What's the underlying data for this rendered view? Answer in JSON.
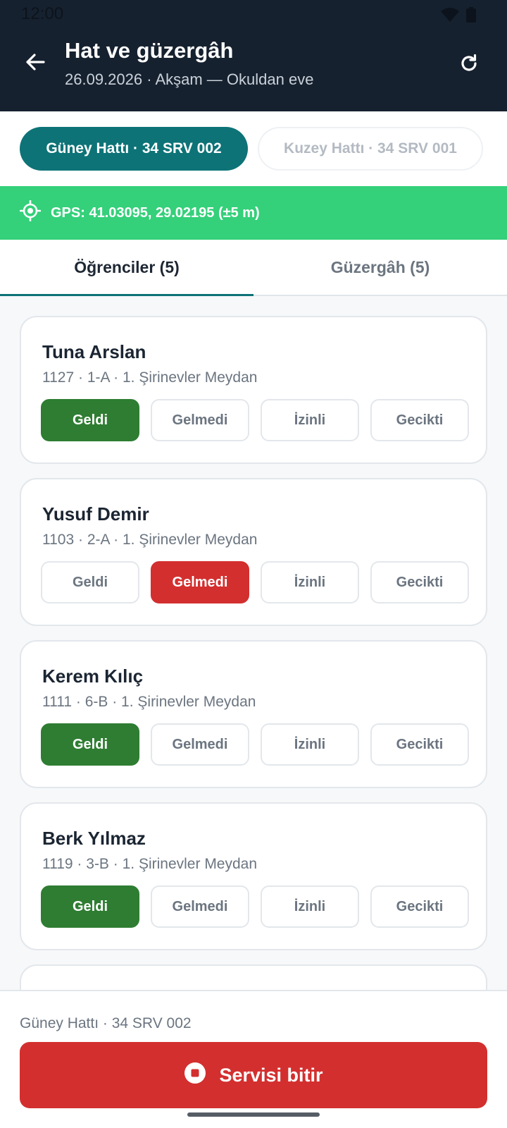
{
  "status_bar": {
    "time": "12:00"
  },
  "header": {
    "title": "Hat ve güzergâh",
    "subtitle": "26.09.2026 · Akşam — Okuldan eve"
  },
  "routes": [
    {
      "label": "Güney Hattı · 34 SRV 002",
      "selected": true
    },
    {
      "label": "Kuzey Hattı · 34 SRV 001",
      "selected": false
    }
  ],
  "gps": {
    "text": "GPS: 41.03095, 29.02195 (±5 m)"
  },
  "tabs": [
    {
      "label": "Öğrenciler (5)",
      "active": true
    },
    {
      "label": "Güzergâh (5)",
      "active": false
    }
  ],
  "attendance_options": [
    "Geldi",
    "Gelmedi",
    "İzinli",
    "Gecikti"
  ],
  "students": [
    {
      "name": "Tuna Arslan",
      "meta": "1127 · 1-A · 1. Şirinevler Meydan",
      "status": "Geldi"
    },
    {
      "name": "Yusuf Demir",
      "meta": "1103 · 2-A · 1. Şirinevler Meydan",
      "status": "Gelmedi"
    },
    {
      "name": "Kerem Kılıç",
      "meta": "1111 · 6-B · 1. Şirinevler Meydan",
      "status": "Geldi"
    },
    {
      "name": "Berk Yılmaz",
      "meta": "1119 · 3-B · 1. Şirinevler Meydan",
      "status": "Geldi"
    }
  ],
  "footer": {
    "route_label": "Güney Hattı · 34 SRV 002",
    "end_button": "Servisi bitir"
  },
  "colors": {
    "header_bg": "#16212f",
    "accent": "#0d7377",
    "gps_bg": "#34d07a",
    "present": "#2e7d32",
    "absent": "#d32f2f"
  }
}
